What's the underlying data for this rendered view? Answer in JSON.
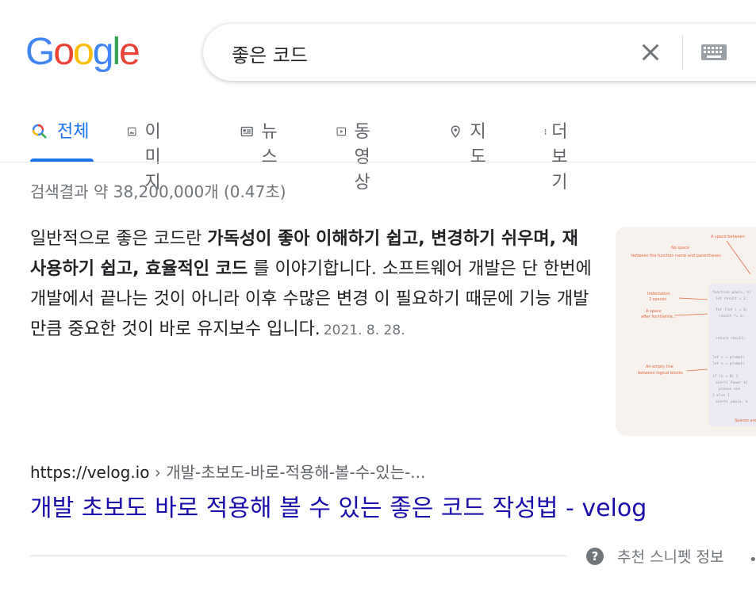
{
  "logo": {
    "letters": [
      {
        "ch": "G",
        "color": "#4285F4"
      },
      {
        "ch": "o",
        "color": "#EA4335"
      },
      {
        "ch": "o",
        "color": "#FBBC05"
      },
      {
        "ch": "g",
        "color": "#4285F4"
      },
      {
        "ch": "l",
        "color": "#34A853"
      },
      {
        "ch": "e",
        "color": "#EA4335"
      }
    ]
  },
  "search": {
    "query": "좋은 코드"
  },
  "tabs": [
    {
      "label": "전체",
      "icon": "search-icon",
      "active": true
    },
    {
      "label": "이미지",
      "icon": "image-icon"
    },
    {
      "label": "뉴스",
      "icon": "news-icon"
    },
    {
      "label": "동영상",
      "icon": "video-icon"
    },
    {
      "label": "지도",
      "icon": "map-pin-icon"
    },
    {
      "label": "더보기",
      "icon": "more-vert-icon"
    }
  ],
  "result_stats": "검색결과 약 38,200,000개 (0.47초)",
  "snippet": {
    "p1": "일반적으로 좋은 코드란 ",
    "bold": "가독성이 좋아 이해하기 쉽고, 변경하기 쉬우며, 재사용하기 쉽고, 효율적인 코드",
    "p2": " 를 이야기합니다. 소프트웨어 개발은 단 한번에 개발에서 끝나는 것이 아니라 이후 수많은 변경 이 필요하기 때문에 기능 개발 만큼 중요한 것이 바로 유지보수 입니다.",
    "date": "2021. 8. 28."
  },
  "result": {
    "domain": "https://velog.io",
    "separator": " › ",
    "path": "개발-초보도-바로-적용해-볼-수-있는-...",
    "title": "개발 초보도 바로 적용해 볼 수 있는 좋은 코드 작성법 - velog"
  },
  "footer": {
    "label": "추천 스니펫 정보",
    "dot": "•"
  },
  "colors": {
    "accent": "#1a73e8",
    "link": "#1a0dab",
    "muted": "#70757a"
  }
}
